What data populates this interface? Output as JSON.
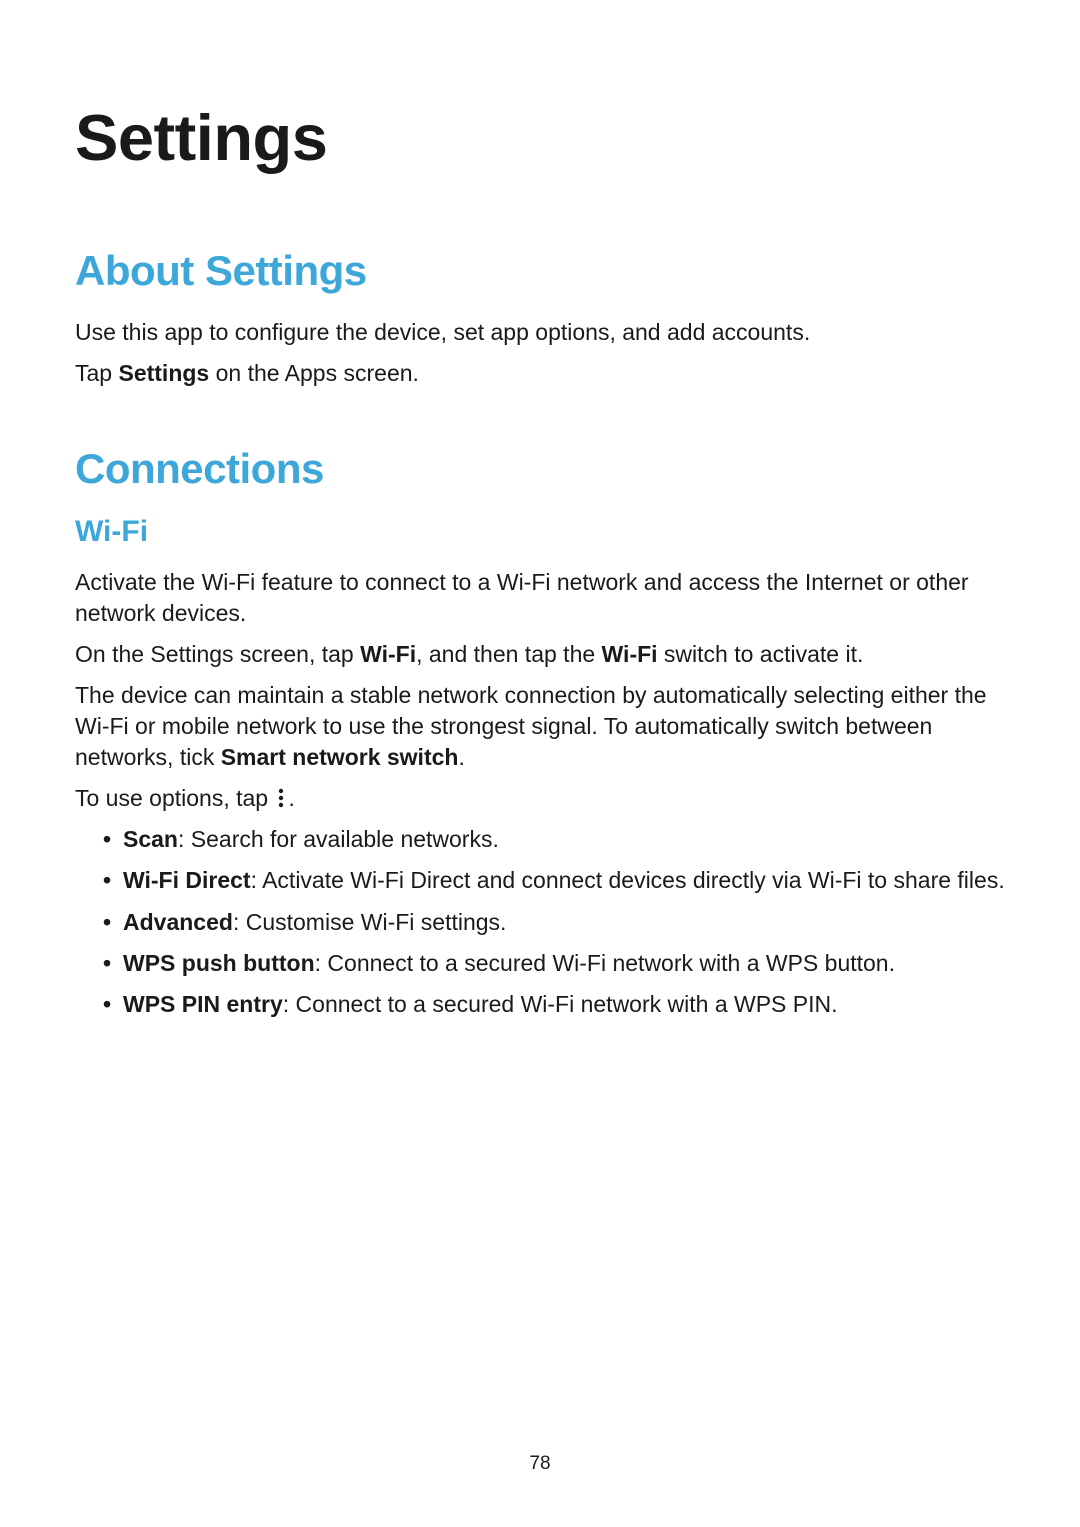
{
  "chapter_title": "Settings",
  "about": {
    "heading": "About Settings",
    "p1": "Use this app to configure the device, set app options, and add accounts.",
    "p2_pre": "Tap ",
    "p2_bold": "Settings",
    "p2_post": " on the Apps screen."
  },
  "connections": {
    "heading": "Connections",
    "wifi": {
      "heading": "Wi-Fi",
      "p1": "Activate the Wi-Fi feature to connect to a Wi-Fi network and access the Internet or other network devices.",
      "p2_pre": "On the Settings screen, tap ",
      "p2_bold1": "Wi-Fi",
      "p2_mid": ", and then tap the ",
      "p2_bold2": "Wi-Fi",
      "p2_post": " switch to activate it.",
      "p3_pre": "The device can maintain a stable network connection by automatically selecting either the Wi-Fi or mobile network to use the strongest signal. To automatically switch between networks, tick ",
      "p3_bold": "Smart network switch",
      "p3_post": ".",
      "p4_pre": "To use options, tap ",
      "p4_post": ".",
      "options": {
        "scan": {
          "name": "Scan",
          "desc": ": Search for available networks."
        },
        "wifi_direct": {
          "name": "Wi-Fi Direct",
          "desc": ": Activate Wi-Fi Direct and connect devices directly via Wi-Fi to share files."
        },
        "advanced": {
          "name": "Advanced",
          "desc": ": Customise Wi-Fi settings."
        },
        "wps_push": {
          "name": "WPS push button",
          "desc": ": Connect to a secured Wi-Fi network with a WPS button."
        },
        "wps_pin": {
          "name": "WPS PIN entry",
          "desc": ": Connect to a secured Wi-Fi network with a WPS PIN."
        }
      }
    }
  },
  "page_number": "78"
}
